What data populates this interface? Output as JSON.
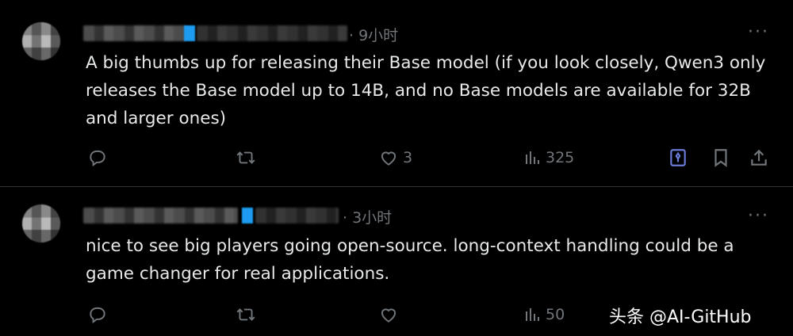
{
  "posts": [
    {
      "time": "· 9小时",
      "text": "A big thumbs up for releasing their Base model (if you look closely, Qwen3 only releases the Base model up to 14B, and no Base models are available for 32B and larger ones)",
      "actions": {
        "reply_count": "",
        "repost_count": "",
        "like_count": "3",
        "view_count": "325"
      }
    },
    {
      "time": "· 3小时",
      "text": "nice to see big players going open-source. long-context handling could be a game changer for real applications.",
      "actions": {
        "reply_count": "",
        "repost_count": "",
        "like_count": "",
        "view_count": "50"
      }
    }
  ],
  "watermark": "头条 @AI-GitHub",
  "colors": {
    "background": "#000000",
    "text": "#e7e9ea",
    "muted": "#71767b",
    "accent": "#6b7bd8",
    "divider": "#2f3336"
  },
  "icons": {
    "reply": "reply-icon",
    "repost": "repost-icon",
    "like": "heart-icon",
    "views": "bar-chart-icon",
    "grok": "grok-icon",
    "bookmark": "bookmark-icon",
    "share": "share-icon",
    "more": "more-icon"
  }
}
